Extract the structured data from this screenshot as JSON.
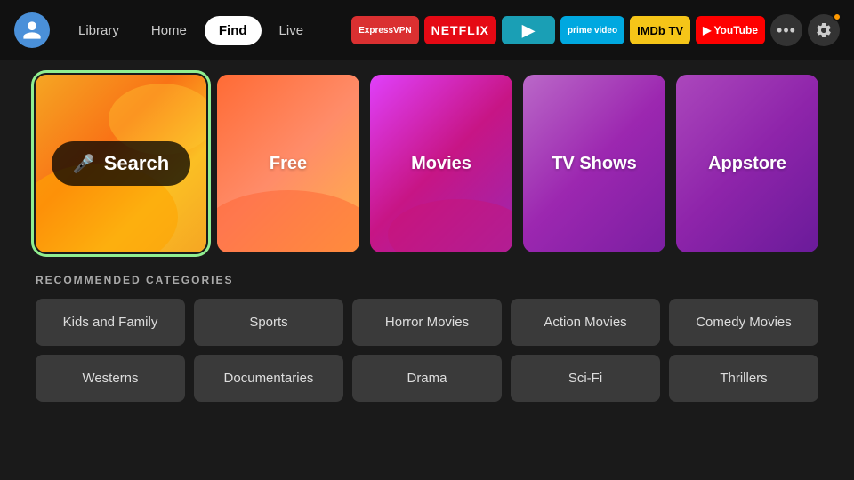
{
  "nav": {
    "avatar_label": "User Avatar",
    "links": [
      {
        "label": "Library",
        "active": false
      },
      {
        "label": "Home",
        "active": false
      },
      {
        "label": "Find",
        "active": true
      },
      {
        "label": "Live",
        "active": false
      }
    ],
    "apps": [
      {
        "id": "expressvpn",
        "label": "ExpressVPN",
        "class": "app-expressvpn"
      },
      {
        "id": "netflix",
        "label": "NETFLIX",
        "class": "app-netflix"
      },
      {
        "id": "freevee",
        "label": "▶",
        "class": "app-freevee"
      },
      {
        "id": "prime",
        "label": "prime video",
        "class": "app-prime"
      },
      {
        "id": "imdb",
        "label": "IMDb TV",
        "class": "app-imdb"
      },
      {
        "id": "youtube",
        "label": "▶ YouTube",
        "class": "app-youtube"
      }
    ],
    "more_label": "•••",
    "settings_label": "⚙"
  },
  "tiles": [
    {
      "id": "search",
      "label": "Search",
      "type": "search"
    },
    {
      "id": "free",
      "label": "Free",
      "type": "free"
    },
    {
      "id": "movies",
      "label": "Movies",
      "type": "movies"
    },
    {
      "id": "tvshows",
      "label": "TV Shows",
      "type": "tvshows"
    },
    {
      "id": "appstore",
      "label": "Appstore",
      "type": "appstore"
    }
  ],
  "section_title": "RECOMMENDED CATEGORIES",
  "categories": [
    [
      "Kids and Family",
      "Sports",
      "Horror Movies",
      "Action Movies",
      "Comedy Movies"
    ],
    [
      "Westerns",
      "Documentaries",
      "Drama",
      "Sci-Fi",
      "Thrillers"
    ]
  ],
  "icons": {
    "mic": "🎤",
    "gear": "⚙",
    "dots": "•••"
  }
}
